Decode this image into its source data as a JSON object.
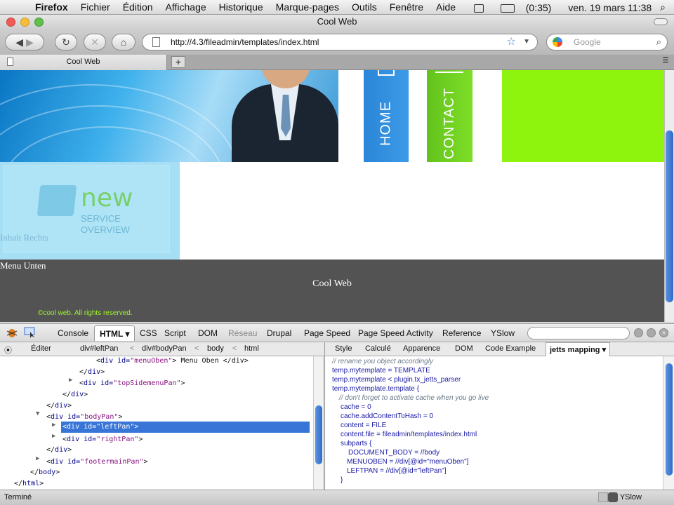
{
  "menubar": {
    "app": "Firefox",
    "items": [
      "Fichier",
      "Édition",
      "Affichage",
      "Historique",
      "Marque-pages",
      "Outils",
      "Fenêtre",
      "Aide"
    ],
    "battery": "(0:35)",
    "datetime": "ven. 19 mars  11:38"
  },
  "window": {
    "title": "Cool Web"
  },
  "toolbar": {
    "url": "http://4.3/fileadmin/templates/index.html",
    "search_placeholder": "Google"
  },
  "tabs": [
    {
      "label": "Cool Web"
    }
  ],
  "site": {
    "nav": [
      "HOME",
      "CONTACT"
    ],
    "promo_word": "new",
    "promo_line1": "SERVICE",
    "promo_line2": "OVERVIEW",
    "inhalt": "Inhalt Rechts",
    "menu_unten": "Menu Unten",
    "footer_title": "Cool Web",
    "copyright": "©cool web. All rights reserved."
  },
  "firebug": {
    "tabs": [
      "Console",
      "HTML",
      "CSS",
      "Script",
      "DOM",
      "Réseau",
      "Drupal",
      "Page Speed",
      "Page Speed Activity",
      "Reference",
      "YSlow"
    ],
    "edit": "Éditer",
    "breadcrumbs": [
      "div#leftPan",
      "div#bodyPan",
      "body",
      "html"
    ],
    "side_tabs": [
      "Style",
      "Calculé",
      "Apparence",
      "DOM",
      "Code Example",
      "jetts mapping"
    ],
    "tree": [
      {
        "pre": "<",
        "tag": "div",
        "attr": " id=",
        "val": "\"menuOben\"",
        "post": "> Menu Oben </div>"
      },
      {
        "pre": "</",
        "tag": "div",
        "post": ">"
      },
      {
        "pre": "<",
        "tag": "div",
        "attr": " id=",
        "val": "\"topSidemenuPan\"",
        "post": ">"
      },
      {
        "pre": "</",
        "tag": "div",
        "post": ">"
      },
      {
        "pre": "</",
        "tag": "div",
        "post": ">"
      },
      {
        "pre": "<",
        "tag": "div",
        "attr": " id=",
        "val": "\"bodyPan\"",
        "post": ">"
      },
      {
        "pre": "<",
        "tag": "div",
        "attr": " id=",
        "val": "\"leftPan\"",
        "post": ">"
      },
      {
        "pre": "<",
        "tag": "div",
        "attr": " id=",
        "val": "\"rightPan\"",
        "post": ">"
      },
      {
        "pre": "</",
        "tag": "div",
        "post": ">"
      },
      {
        "pre": "<",
        "tag": "div",
        "attr": " id=",
        "val": "\"footermainPan\"",
        "post": ">"
      },
      {
        "pre": "</",
        "tag": "body",
        "post": ">"
      },
      {
        "pre": "</",
        "tag": "html",
        "post": ">"
      }
    ],
    "code": [
      "// rename you object accordingly",
      "temp.mytemplate = TEMPLATE",
      "temp.mytemplate < plugin.tx_jetts_parser",
      "temp.mytemplate.template {",
      "// don't forget to activate cache when you go live",
      "cache = 0",
      "cache.addContentToHash = 0",
      "content = FILE",
      "content.file = fileadmin/templates/index.html",
      "subparts {",
      "DOCUMENT_BODY = //body",
      "MENUOBEN = //div[@id=\"menuOben\"]",
      "LEFTPAN = //div[@id=\"leftPan\"]",
      "}"
    ]
  },
  "status": {
    "text": "Terminé",
    "yslow": "YSlow"
  }
}
